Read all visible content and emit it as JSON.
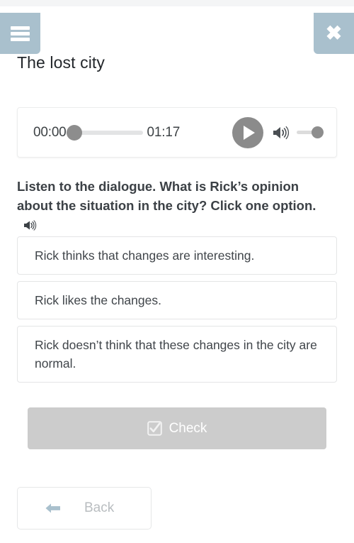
{
  "header": {
    "menu_icon": "hamburger-menu-icon",
    "close_icon": "close-icon",
    "title": "The lost city"
  },
  "audio_player": {
    "current_time": "00:00",
    "total_time": "01:17",
    "play_icon": "play-icon",
    "volume_icon": "speaker-icon",
    "progress_percent": 0,
    "volume_percent": 100
  },
  "question": {
    "text": "Listen to the dialogue. What is Rick’s opinion about the situation in the city? Click one option.",
    "speaker_icon": "speaker-icon"
  },
  "options": [
    {
      "label": "Rick thinks that changes are interesting."
    },
    {
      "label": "Rick likes the changes."
    },
    {
      "label": "Rick doesn’t think that these changes in the city are normal."
    }
  ],
  "actions": {
    "check_label": "Check",
    "check_icon": "checkbox-checked-icon",
    "back_label": "Back",
    "back_icon": "arrow-left-icon"
  },
  "colors": {
    "header_button": "#a9c0cd",
    "check_disabled": "#cccccc",
    "player_gray": "#8b8b8b",
    "text_primary": "#3c4146",
    "back_text": "#b9bdc0"
  }
}
